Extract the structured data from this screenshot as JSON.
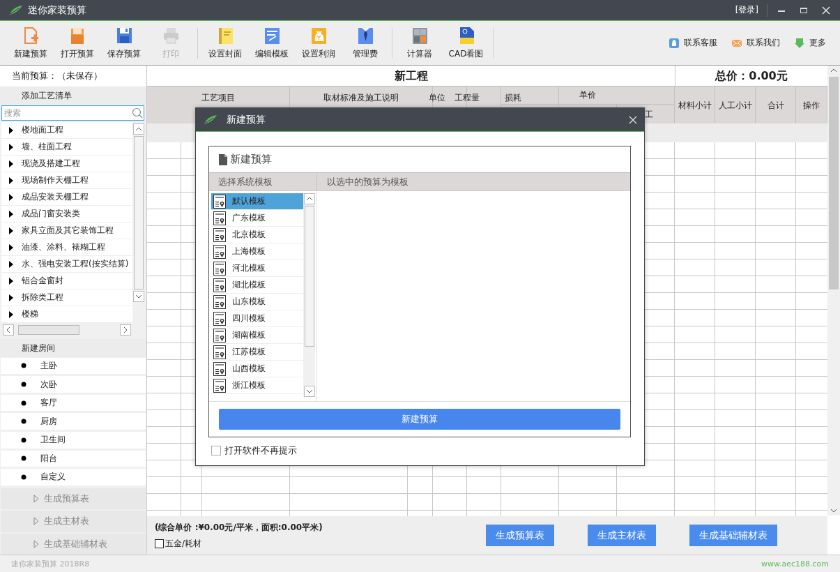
{
  "window": {
    "title": "迷你家装预算",
    "login": "[登录]"
  },
  "toolbar": [
    {
      "label": "新建预算",
      "disabled": false,
      "separator_before": false
    },
    {
      "label": "打开预算",
      "disabled": false,
      "separator_before": false
    },
    {
      "label": "保存预算",
      "disabled": false,
      "separator_before": false
    },
    {
      "label": "打印",
      "disabled": true,
      "separator_before": false
    },
    {
      "label": "设置封面",
      "disabled": false,
      "separator_before": true
    },
    {
      "label": "编辑模板",
      "disabled": false,
      "separator_before": false
    },
    {
      "label": "设置利润",
      "disabled": false,
      "separator_before": false
    },
    {
      "label": "管理费",
      "disabled": false,
      "separator_before": false
    },
    {
      "label": "计算器",
      "disabled": false,
      "separator_before": true
    },
    {
      "label": "CAD看图",
      "disabled": false,
      "separator_before": false
    }
  ],
  "toolbar_links": [
    {
      "label": "联系客服"
    },
    {
      "label": "联系我们"
    },
    {
      "label": "更多"
    }
  ],
  "left_panel": {
    "current_budget": "当前预算：（未保存）",
    "craft_header": "添加工艺清单",
    "search": {
      "placeholder": "搜索"
    },
    "craft_items": [
      {
        "label": "楼地面工程",
        "expanded": false
      },
      {
        "label": "墙、柱面工程",
        "expanded": false
      },
      {
        "label": "现浇及搭建工程",
        "expanded": false
      },
      {
        "label": "现场制作天棚工程",
        "expanded": false
      },
      {
        "label": "成品安装天棚工程",
        "expanded": false
      },
      {
        "label": "成品门窗安装类",
        "expanded": false
      },
      {
        "label": "家具立面及其它装饰工程",
        "expanded": false
      },
      {
        "label": "油漆、涂料、裱糊工程",
        "expanded": false
      },
      {
        "label": "水、强电安装工程(按实结算)",
        "expanded": false
      },
      {
        "label": "铝合金窗封",
        "expanded": false
      },
      {
        "label": "拆除类工程",
        "expanded": false
      },
      {
        "label": "楼梯",
        "expanded": false
      }
    ],
    "room_header": "新建房间",
    "rooms": [
      "主卧",
      "次卧",
      "客厅",
      "厨房",
      "卫生间",
      "阳台",
      "自定义"
    ],
    "generate": [
      "生成预算表",
      "生成主材表",
      "生成基础辅材表"
    ]
  },
  "sheet": {
    "title": "新工程",
    "total": "总价：0.00元",
    "columns_left": [
      "工艺项目",
      "取材标准及施工说明",
      "单位",
      "工程量",
      "损耗"
    ],
    "unit_price": {
      "label": "单价",
      "sub_column_3": "工"
    },
    "columns_right": [
      "材料小计",
      "人工小计",
      "合计",
      "操作"
    ],
    "summary": "(综合单价 :¥0.00元/平米，面积:0.00平米)",
    "hardware": {
      "label": "五金/耗材",
      "checked": false
    },
    "buttons": [
      "生成预算表",
      "生成主材表",
      "生成基础辅材表"
    ]
  },
  "dialog": {
    "title": "新建预算",
    "heading": "新建预算",
    "column_1": "选择系统模板",
    "column_2": "以选中的预算为模板",
    "templates": [
      {
        "label": "默认模板",
        "selected": true
      },
      {
        "label": "广东模板",
        "selected": false
      },
      {
        "label": "北京模板",
        "selected": false
      },
      {
        "label": "上海模板",
        "selected": false
      },
      {
        "label": "河北模板",
        "selected": false
      },
      {
        "label": "湖北模板",
        "selected": false
      },
      {
        "label": "山东模板",
        "selected": false
      },
      {
        "label": "四川模板",
        "selected": false
      },
      {
        "label": "湖南模板",
        "selected": false
      },
      {
        "label": "江苏模板",
        "selected": false
      },
      {
        "label": "山西模板",
        "selected": false
      },
      {
        "label": "浙江模板",
        "selected": false
      }
    ],
    "button": "新建预算",
    "dont_show": {
      "label": "打开软件不再提示",
      "checked": false
    }
  },
  "status_bar": {
    "version": "迷你家装预算 2018R8",
    "website": "www.aec188.com"
  }
}
